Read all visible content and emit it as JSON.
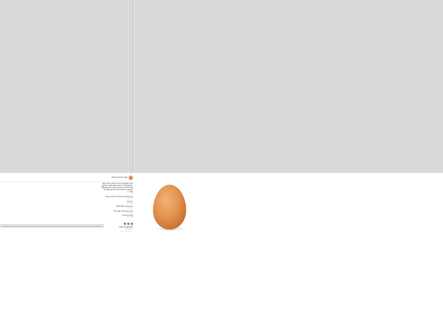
{
  "post": {
    "username": "world_record_egg",
    "caption": "Let's set a world record together and get the most liked post on Instagram. Beating the current world record held by Kylie Jenner (18 million)! We got this 🙌",
    "caption_meta": "2d",
    "image_alt": "egg photo"
  },
  "comments": [
    {
      "text": "Kylie Jenner lost the world record",
      "meta": "2d  Reply"
    },
    {
      "text": "🥚🥚🥚",
      "meta": "2d  Reply"
    },
    {
      "text": "Most liked post ever",
      "meta": "2d  Reply"
    },
    {
      "text": "This egg is famous now",
      "meta": "2d  Reply"
    },
    {
      "text": "Let's go egg!",
      "meta": "2d  Reply"
    }
  ],
  "likes_text": "18,423,920 likes",
  "date_text": "JANUARY 4",
  "add_comment_placeholder": "Add a comment...",
  "colors": {
    "placeholder_gray": "#d9d9d9",
    "egg": "#e3924f",
    "avatar_ring": "#e05a2a"
  },
  "icons": [
    "heart-icon",
    "comment-icon",
    "share-icon",
    "bookmark-icon"
  ]
}
